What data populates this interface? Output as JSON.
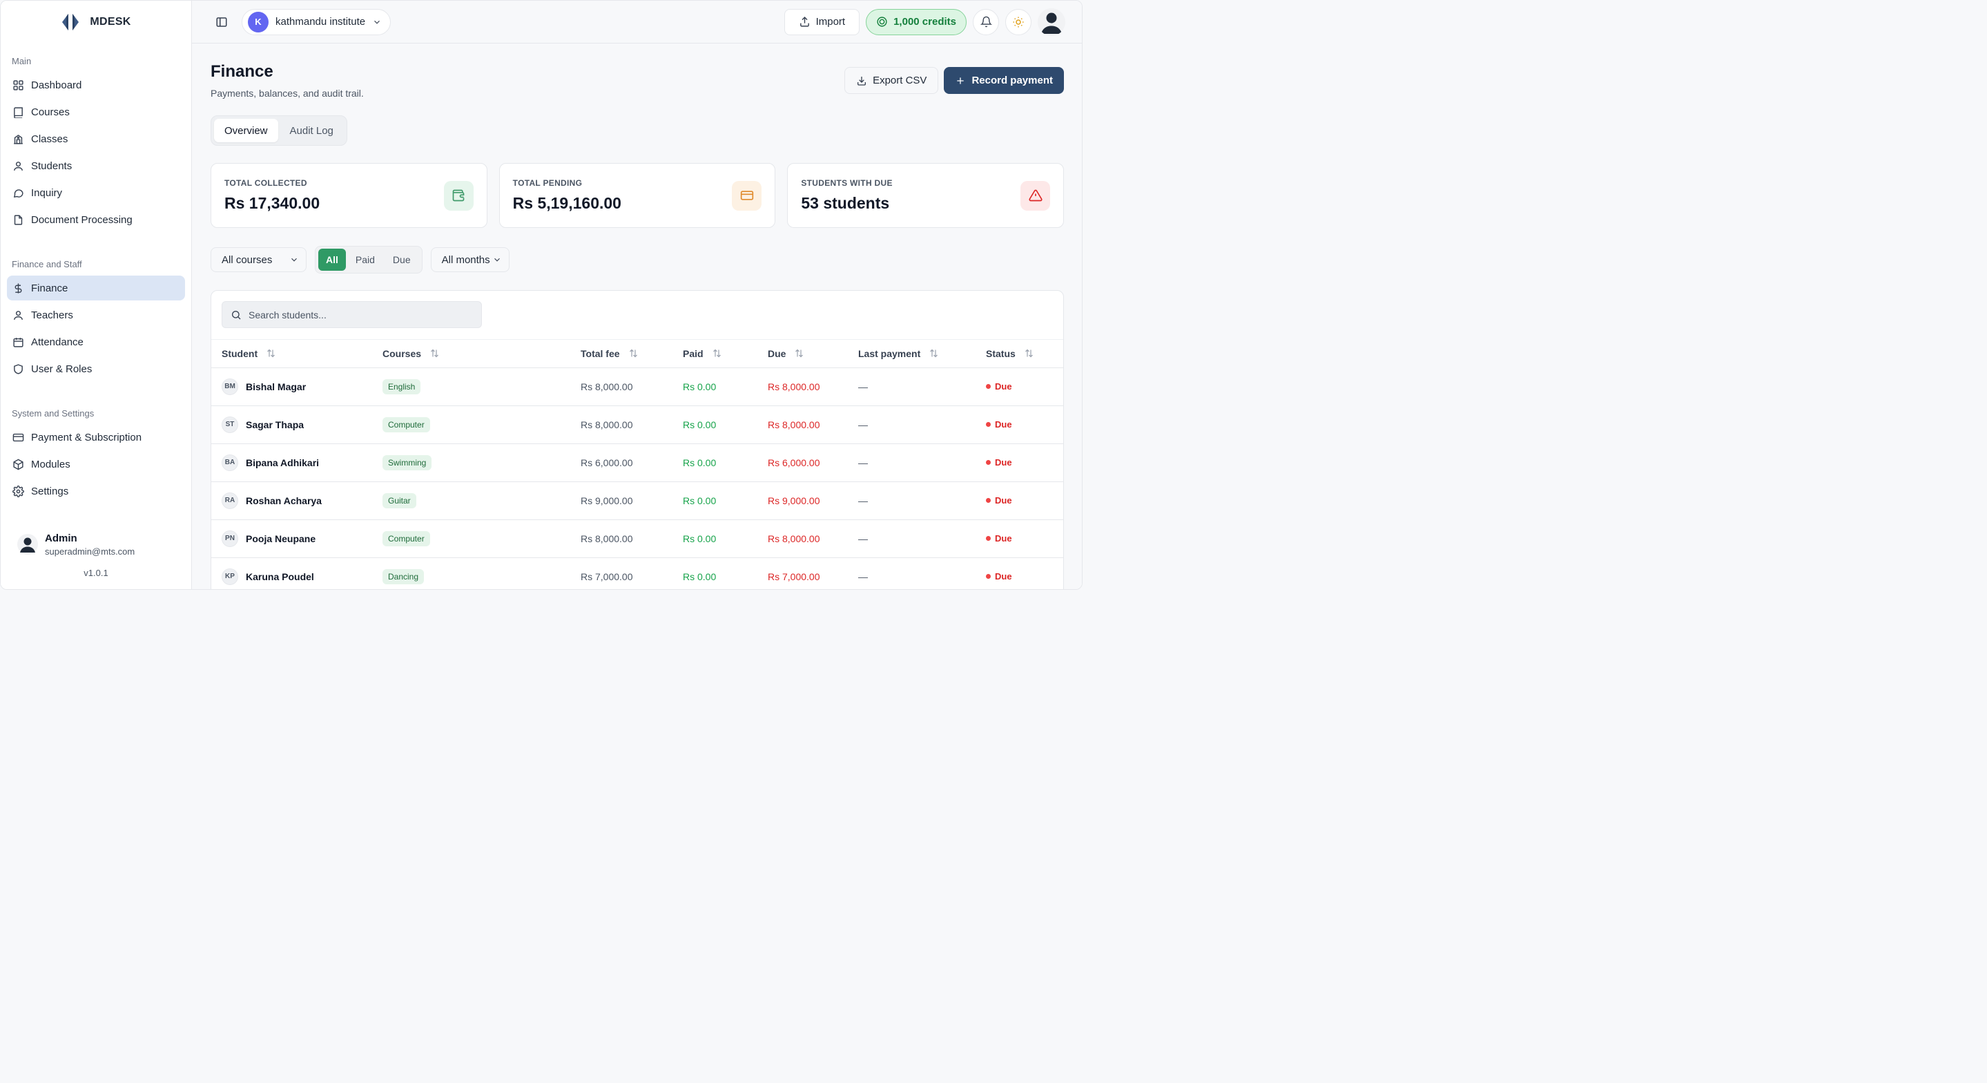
{
  "brand": {
    "name": "MDESK"
  },
  "sidebar": {
    "sections": [
      {
        "title": "Main",
        "items": [
          {
            "label": "Dashboard",
            "icon": "dashboard-icon"
          },
          {
            "label": "Courses",
            "icon": "book-icon"
          },
          {
            "label": "Classes",
            "icon": "school-icon"
          },
          {
            "label": "Students",
            "icon": "user-icon"
          },
          {
            "label": "Inquiry",
            "icon": "chat-bubble-icon"
          },
          {
            "label": "Document Processing",
            "icon": "document-icon"
          }
        ]
      },
      {
        "title": "Finance and Staff",
        "items": [
          {
            "label": "Finance",
            "icon": "dollar-icon",
            "active": true
          },
          {
            "label": "Teachers",
            "icon": "user-icon"
          },
          {
            "label": "Attendance",
            "icon": "calendar-icon"
          },
          {
            "label": "User & Roles",
            "icon": "shield-icon"
          }
        ]
      },
      {
        "title": "System and Settings",
        "items": [
          {
            "label": "Payment & Subscription",
            "icon": "credit-card-icon"
          },
          {
            "label": "Modules",
            "icon": "package-icon"
          },
          {
            "label": "Settings",
            "icon": "gear-icon"
          }
        ]
      }
    ],
    "user": {
      "name": "Admin",
      "email": "superadmin@mts.com"
    },
    "version": "v1.0.1"
  },
  "topbar": {
    "org_initial": "K",
    "org_name": "kathmandu institute",
    "import_label": "Import",
    "credits_label": "1,000 credits"
  },
  "page": {
    "title": "Finance",
    "subtitle": "Payments, balances, and audit trail.",
    "export_label": "Export CSV",
    "record_label": "Record payment",
    "tabs": [
      "Overview",
      "Audit Log"
    ],
    "active_tab": 0
  },
  "stats": [
    {
      "label": "TOTAL COLLECTED",
      "value": "Rs 17,340.00",
      "icon": "wallet-icon",
      "accent": "#3f9a6a",
      "bg": "#e6f5ec"
    },
    {
      "label": "TOTAL PENDING",
      "value": "Rs 5,19,160.00",
      "icon": "credit-card-icon",
      "accent": "#e08a2c",
      "bg": "#fdf1e3"
    },
    {
      "label": "STUDENTS WITH DUE",
      "value": "53 students",
      "icon": "alert-triangle-icon",
      "accent": "#dc2626",
      "bg": "#fde8e8"
    }
  ],
  "filters": {
    "courses_value": "All courses",
    "months_value": "All months",
    "segments": [
      "All",
      "Paid",
      "Due"
    ],
    "active_segment": 0
  },
  "search": {
    "placeholder": "Search students..."
  },
  "table": {
    "columns": [
      "Student",
      "Courses",
      "Total fee",
      "Paid",
      "Due",
      "Last payment",
      "Status"
    ],
    "rows": [
      {
        "initials": "BM",
        "name": "Bishal Magar",
        "course": "English",
        "total": "Rs 8,000.00",
        "paid": "Rs 0.00",
        "due": "Rs 8,000.00",
        "last": "—",
        "status": "Due"
      },
      {
        "initials": "ST",
        "name": "Sagar Thapa",
        "course": "Computer",
        "total": "Rs 8,000.00",
        "paid": "Rs 0.00",
        "due": "Rs 8,000.00",
        "last": "—",
        "status": "Due"
      },
      {
        "initials": "BA",
        "name": "Bipana Adhikari",
        "course": "Swimming",
        "total": "Rs 6,000.00",
        "paid": "Rs 0.00",
        "due": "Rs 6,000.00",
        "last": "—",
        "status": "Due"
      },
      {
        "initials": "RA",
        "name": "Roshan Acharya",
        "course": "Guitar",
        "total": "Rs 9,000.00",
        "paid": "Rs 0.00",
        "due": "Rs 9,000.00",
        "last": "—",
        "status": "Due"
      },
      {
        "initials": "PN",
        "name": "Pooja Neupane",
        "course": "Computer",
        "total": "Rs 8,000.00",
        "paid": "Rs 0.00",
        "due": "Rs 8,000.00",
        "last": "—",
        "status": "Due"
      },
      {
        "initials": "KP",
        "name": "Karuna Poudel",
        "course": "Dancing",
        "total": "Rs 7,000.00",
        "paid": "Rs 0.00",
        "due": "Rs 7,000.00",
        "last": "—",
        "status": "Due"
      }
    ]
  }
}
